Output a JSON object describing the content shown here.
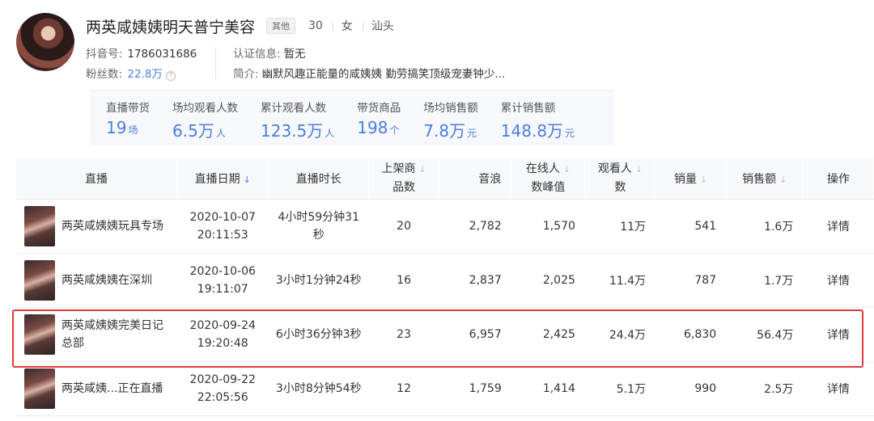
{
  "profile": {
    "name": "两英咸姨姨明天普宁美容",
    "tag": "其他",
    "age": "30",
    "gender": "女",
    "city": "汕头",
    "douyin_label": "抖音号:",
    "douyin_id": "1786031686",
    "fans_label": "粉丝数:",
    "fans": "22.8万",
    "cert_label": "认证信息:",
    "cert": "暂无",
    "bio_label": "简介:",
    "bio": "幽默风趣正能量的咸姨姨 勤劳搞笑顶级宠妻钟少..."
  },
  "stats": [
    {
      "label": "直播带货",
      "value": "19",
      "unit": "场"
    },
    {
      "label": "场均观看人数",
      "value": "6.5万",
      "unit": "人"
    },
    {
      "label": "累计观看人数",
      "value": "123.5万",
      "unit": "人"
    },
    {
      "label": "带货商品",
      "value": "198",
      "unit": "个"
    },
    {
      "label": "场均销售额",
      "value": "7.8万",
      "unit": "元"
    },
    {
      "label": "累计销售额",
      "value": "148.8万",
      "unit": "元"
    }
  ],
  "table": {
    "headers": {
      "live": "直播",
      "date": "直播日期",
      "duration": "直播时长",
      "products_l1": "上架商",
      "products_l2": "品数",
      "sound": "音浪",
      "peak_l1": "在线人",
      "peak_l2": "数峰值",
      "viewers_l1": "观看人",
      "viewers_l2": "数",
      "sales": "销量",
      "revenue": "销售额",
      "action": "操作"
    },
    "rows": [
      {
        "title": "两英咸姨姨玩具专场",
        "date": "2020-10-07",
        "time": "20:11:53",
        "duration": "4小时59分钟31秒",
        "products": "20",
        "sound": "2,782",
        "peak": "1,570",
        "viewers": "11万",
        "sales": "541",
        "revenue": "1.6万",
        "action": "详情"
      },
      {
        "title": "两英咸姨姨在深圳",
        "date": "2020-10-06",
        "time": "19:11:07",
        "duration": "3小时1分钟24秒",
        "products": "16",
        "sound": "2,837",
        "peak": "2,025",
        "viewers": "11.4万",
        "sales": "787",
        "revenue": "1.7万",
        "action": "详情"
      },
      {
        "title": "两英咸姨姨完美日记总部",
        "date": "2020-09-24",
        "time": "19:20:48",
        "duration": "6小时36分钟3秒",
        "products": "23",
        "sound": "6,957",
        "peak": "2,425",
        "viewers": "24.4万",
        "sales": "6,830",
        "revenue": "56.4万",
        "action": "详情"
      },
      {
        "title": "两英咸姨...正在直播",
        "date": "2020-09-22",
        "time": "22:05:56",
        "duration": "3小时8分钟54秒",
        "products": "12",
        "sound": "1,759",
        "peak": "1,414",
        "viewers": "5.1万",
        "sales": "990",
        "revenue": "2.5万",
        "action": "详情"
      }
    ]
  }
}
